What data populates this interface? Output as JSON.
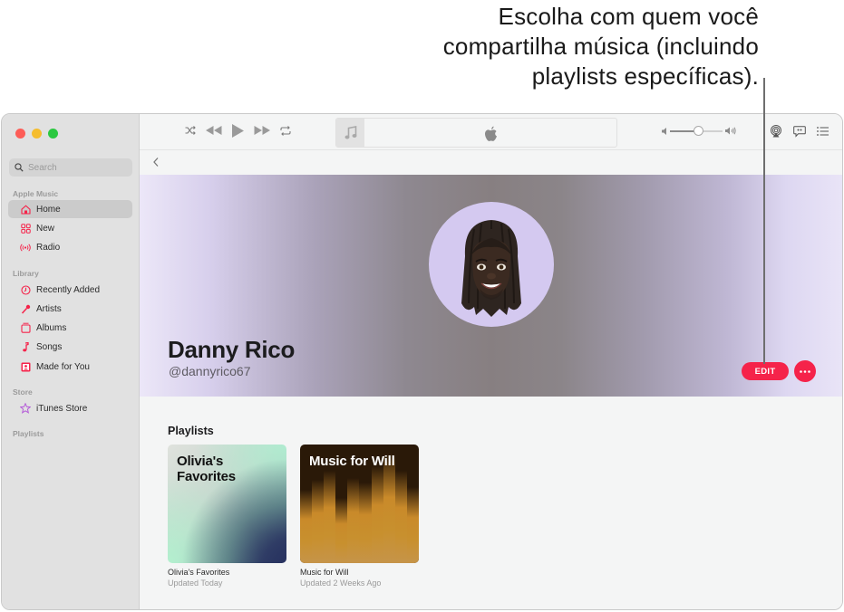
{
  "callout": {
    "lines": [
      "Escolha com quem você",
      "compartilha música (incluindo",
      "playlists específicas)."
    ]
  },
  "sidebar": {
    "search_placeholder": "Search",
    "sections": [
      {
        "title": "Apple Music",
        "items": [
          {
            "label": "Home",
            "icon": "house-icon",
            "active": true
          },
          {
            "label": "New",
            "icon": "grid-icon"
          },
          {
            "label": "Radio",
            "icon": "radio-waves-icon"
          }
        ]
      },
      {
        "title": "Library",
        "items": [
          {
            "label": "Recently Added",
            "icon": "clock-icon"
          },
          {
            "label": "Artists",
            "icon": "microphone-icon"
          },
          {
            "label": "Albums",
            "icon": "album-stack-icon"
          },
          {
            "label": "Songs",
            "icon": "music-note-icon"
          },
          {
            "label": "Made for You",
            "icon": "person-square-icon"
          }
        ]
      },
      {
        "title": "Store",
        "items": [
          {
            "label": "iTunes Store",
            "icon": "star-icon"
          }
        ]
      },
      {
        "title": "Playlists",
        "items": []
      }
    ]
  },
  "player": {
    "volume": 0.55
  },
  "profile": {
    "name": "Danny Rico",
    "handle": "@dannyrico67",
    "edit_label": "EDIT",
    "more_label": "···"
  },
  "playlists": {
    "heading": "Playlists",
    "items": [
      {
        "cover_title": "Olivia's Favorites",
        "title": "Olivia's Favorites",
        "subtitle": "Updated Today"
      },
      {
        "cover_title": "Music for Will",
        "title": "Music for Will",
        "subtitle": "Updated 2 Weeks Ago"
      }
    ]
  },
  "colors": {
    "accent": "#f5234a",
    "sidebar_icon": "#f5234a",
    "store_icon": "#b45ad8"
  }
}
